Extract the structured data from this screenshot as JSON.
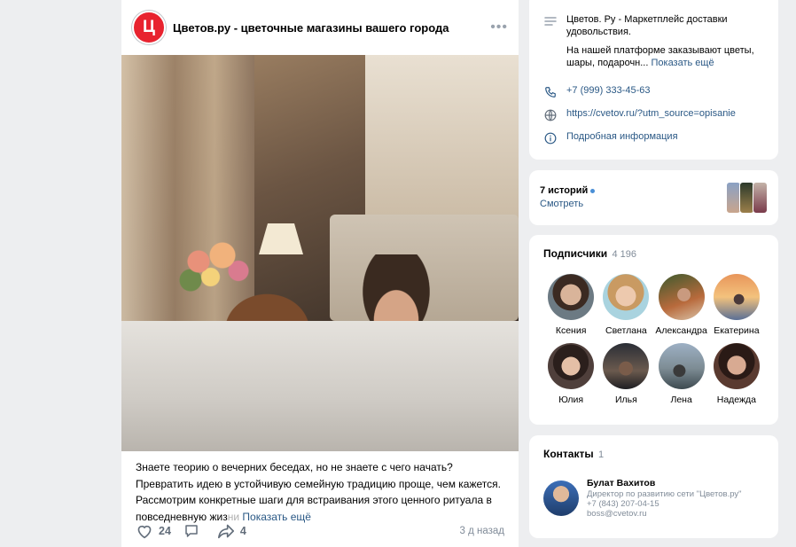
{
  "post": {
    "group_logo_letter": "Ц",
    "group_name": "Цветов.ру - цветочные магазины вашего города",
    "more_icon": "more-horizontal-icon",
    "text_body": "Знаете теорию о вечерних беседах, но не знаете с чего начать? Превратить идею в устойчивую семейную традицию проще, чем кажется. Рассмотрим конкретные шаги для встраивания этого ценного ритуала в повседневную жиз",
    "text_fade": "ни",
    "show_more": "Показать ещё",
    "likes": "24",
    "shares": "4",
    "time": "3 д назад"
  },
  "info": {
    "description_line1": "Цветов. Ру - Маркетплейс доставки удовольствия.",
    "description_line2": "На нашей платформе заказывают цветы, шары, подарочн...",
    "show_more": "Показать ещё",
    "phone": "+7 (999) 333-45-63",
    "website": "https://cvetov.ru/?utm_source=opisanie",
    "details": "Подробная информация"
  },
  "stories": {
    "count_label": "7 историй",
    "watch": "Смотреть"
  },
  "subscribers": {
    "title": "Подписчики",
    "count": "4 196",
    "items": [
      {
        "name": "Ксения"
      },
      {
        "name": "Светлана"
      },
      {
        "name": "Александра"
      },
      {
        "name": "Екатерина"
      },
      {
        "name": "Юлия"
      },
      {
        "name": "Илья"
      },
      {
        "name": "Лена"
      },
      {
        "name": "Надежда"
      }
    ]
  },
  "contacts": {
    "title": "Контакты",
    "count": "1",
    "name": "Булат Вахитов",
    "role": "Директор по развитию сети \"Цветов.ру\"",
    "phone": "+7 (843) 207-04-15",
    "email": "boss@cvetov.ru"
  },
  "colors": {
    "accent": "#2a5885",
    "brand_red": "#e8232f",
    "background": "#edeef0"
  }
}
